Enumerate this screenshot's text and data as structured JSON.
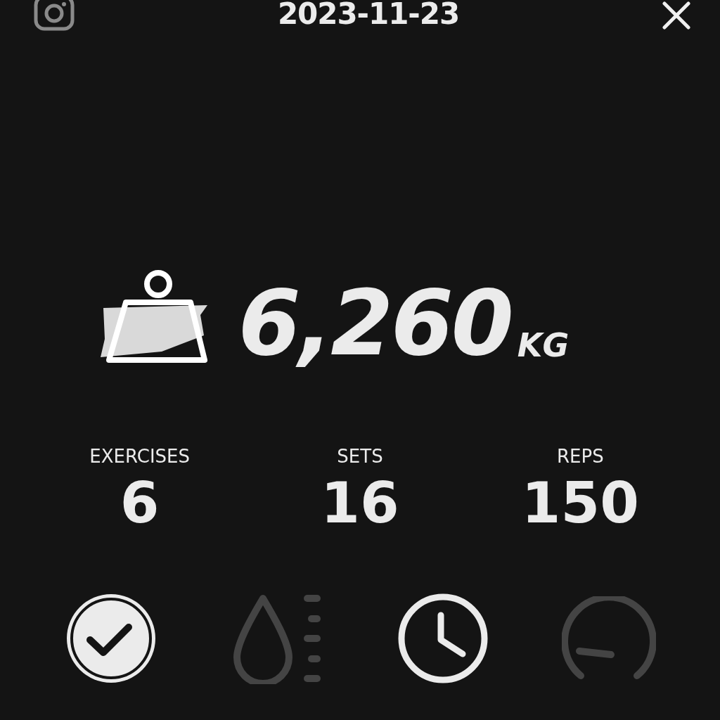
{
  "header": {
    "title": "2023-11-23"
  },
  "total": {
    "value": "6,260",
    "unit": "KG"
  },
  "stats": [
    {
      "label": "EXERCISES",
      "value": "6"
    },
    {
      "label": "SETS",
      "value": "16"
    },
    {
      "label": "REPS",
      "value": "150"
    }
  ],
  "tabs": [
    {
      "kind": "check",
      "on": true
    },
    {
      "kind": "drop",
      "on": false
    },
    {
      "kind": "clock",
      "on": true
    },
    {
      "kind": "gauge",
      "on": false
    }
  ]
}
